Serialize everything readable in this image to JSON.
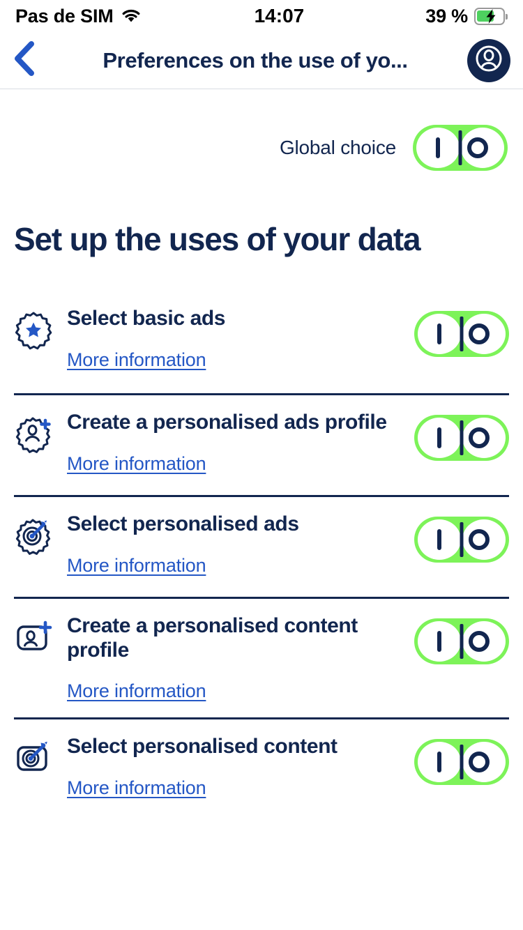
{
  "status_bar": {
    "carrier": "Pas de SIM",
    "wifi_icon": "wifi-icon",
    "time": "14:07",
    "battery_percent": "39 %",
    "battery_icon": "battery-charging-icon"
  },
  "header": {
    "back_icon": "chevron-left-icon",
    "title": "Preferences on the use of yo...",
    "avatar_icon": "user-account-icon"
  },
  "global_choice": {
    "label": "Global choice",
    "toggle": {
      "on_mark": "I",
      "off_mark": "O",
      "state": "on"
    }
  },
  "section": {
    "title": "Set up the uses of your data"
  },
  "rows": [
    {
      "icon": "badge-star-icon",
      "title": "Select basic ads",
      "link": "More information",
      "toggle": {
        "on_mark": "I",
        "off_mark": "O",
        "state": "on"
      }
    },
    {
      "icon": "badge-person-plus-icon",
      "title": "Create a personalised ads profile",
      "link": "More information",
      "toggle": {
        "on_mark": "I",
        "off_mark": "O",
        "state": "on"
      }
    },
    {
      "icon": "badge-target-dart-icon",
      "title": "Select personalised ads",
      "link": "More information",
      "toggle": {
        "on_mark": "I",
        "off_mark": "O",
        "state": "on"
      }
    },
    {
      "icon": "card-person-plus-icon",
      "title": "Create a personalised content profile",
      "link": "More information",
      "toggle": {
        "on_mark": "I",
        "off_mark": "O",
        "state": "on"
      }
    },
    {
      "icon": "card-target-dart-icon",
      "title": "Select personalised content",
      "link": "More information",
      "toggle": {
        "on_mark": "I",
        "off_mark": "O",
        "state": "on"
      }
    }
  ],
  "colors": {
    "navy": "#12264f",
    "link_blue": "#2457c5",
    "accent_green": "#7df359",
    "battery_green": "#4ed15f",
    "separator": "#12264f"
  }
}
